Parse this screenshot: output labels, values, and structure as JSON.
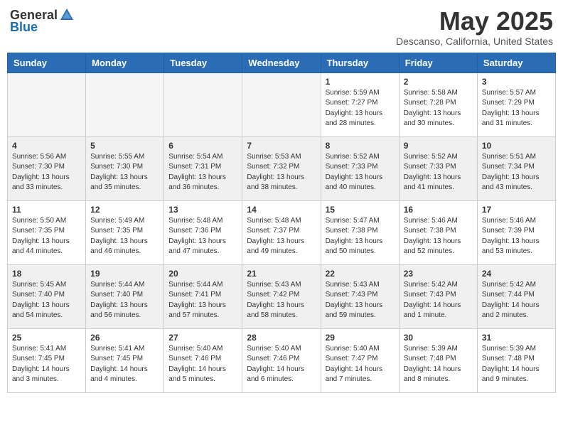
{
  "header": {
    "logo_general": "General",
    "logo_blue": "Blue",
    "month_title": "May 2025",
    "subtitle": "Descanso, California, United States"
  },
  "days_of_week": [
    "Sunday",
    "Monday",
    "Tuesday",
    "Wednesday",
    "Thursday",
    "Friday",
    "Saturday"
  ],
  "weeks": [
    [
      {
        "day": "",
        "info": ""
      },
      {
        "day": "",
        "info": ""
      },
      {
        "day": "",
        "info": ""
      },
      {
        "day": "",
        "info": ""
      },
      {
        "day": "1",
        "info": "Sunrise: 5:59 AM\nSunset: 7:27 PM\nDaylight: 13 hours\nand 28 minutes."
      },
      {
        "day": "2",
        "info": "Sunrise: 5:58 AM\nSunset: 7:28 PM\nDaylight: 13 hours\nand 30 minutes."
      },
      {
        "day": "3",
        "info": "Sunrise: 5:57 AM\nSunset: 7:29 PM\nDaylight: 13 hours\nand 31 minutes."
      }
    ],
    [
      {
        "day": "4",
        "info": "Sunrise: 5:56 AM\nSunset: 7:30 PM\nDaylight: 13 hours\nand 33 minutes."
      },
      {
        "day": "5",
        "info": "Sunrise: 5:55 AM\nSunset: 7:30 PM\nDaylight: 13 hours\nand 35 minutes."
      },
      {
        "day": "6",
        "info": "Sunrise: 5:54 AM\nSunset: 7:31 PM\nDaylight: 13 hours\nand 36 minutes."
      },
      {
        "day": "7",
        "info": "Sunrise: 5:53 AM\nSunset: 7:32 PM\nDaylight: 13 hours\nand 38 minutes."
      },
      {
        "day": "8",
        "info": "Sunrise: 5:52 AM\nSunset: 7:33 PM\nDaylight: 13 hours\nand 40 minutes."
      },
      {
        "day": "9",
        "info": "Sunrise: 5:52 AM\nSunset: 7:33 PM\nDaylight: 13 hours\nand 41 minutes."
      },
      {
        "day": "10",
        "info": "Sunrise: 5:51 AM\nSunset: 7:34 PM\nDaylight: 13 hours\nand 43 minutes."
      }
    ],
    [
      {
        "day": "11",
        "info": "Sunrise: 5:50 AM\nSunset: 7:35 PM\nDaylight: 13 hours\nand 44 minutes."
      },
      {
        "day": "12",
        "info": "Sunrise: 5:49 AM\nSunset: 7:35 PM\nDaylight: 13 hours\nand 46 minutes."
      },
      {
        "day": "13",
        "info": "Sunrise: 5:48 AM\nSunset: 7:36 PM\nDaylight: 13 hours\nand 47 minutes."
      },
      {
        "day": "14",
        "info": "Sunrise: 5:48 AM\nSunset: 7:37 PM\nDaylight: 13 hours\nand 49 minutes."
      },
      {
        "day": "15",
        "info": "Sunrise: 5:47 AM\nSunset: 7:38 PM\nDaylight: 13 hours\nand 50 minutes."
      },
      {
        "day": "16",
        "info": "Sunrise: 5:46 AM\nSunset: 7:38 PM\nDaylight: 13 hours\nand 52 minutes."
      },
      {
        "day": "17",
        "info": "Sunrise: 5:46 AM\nSunset: 7:39 PM\nDaylight: 13 hours\nand 53 minutes."
      }
    ],
    [
      {
        "day": "18",
        "info": "Sunrise: 5:45 AM\nSunset: 7:40 PM\nDaylight: 13 hours\nand 54 minutes."
      },
      {
        "day": "19",
        "info": "Sunrise: 5:44 AM\nSunset: 7:40 PM\nDaylight: 13 hours\nand 56 minutes."
      },
      {
        "day": "20",
        "info": "Sunrise: 5:44 AM\nSunset: 7:41 PM\nDaylight: 13 hours\nand 57 minutes."
      },
      {
        "day": "21",
        "info": "Sunrise: 5:43 AM\nSunset: 7:42 PM\nDaylight: 13 hours\nand 58 minutes."
      },
      {
        "day": "22",
        "info": "Sunrise: 5:43 AM\nSunset: 7:43 PM\nDaylight: 13 hours\nand 59 minutes."
      },
      {
        "day": "23",
        "info": "Sunrise: 5:42 AM\nSunset: 7:43 PM\nDaylight: 14 hours\nand 1 minute."
      },
      {
        "day": "24",
        "info": "Sunrise: 5:42 AM\nSunset: 7:44 PM\nDaylight: 14 hours\nand 2 minutes."
      }
    ],
    [
      {
        "day": "25",
        "info": "Sunrise: 5:41 AM\nSunset: 7:45 PM\nDaylight: 14 hours\nand 3 minutes."
      },
      {
        "day": "26",
        "info": "Sunrise: 5:41 AM\nSunset: 7:45 PM\nDaylight: 14 hours\nand 4 minutes."
      },
      {
        "day": "27",
        "info": "Sunrise: 5:40 AM\nSunset: 7:46 PM\nDaylight: 14 hours\nand 5 minutes."
      },
      {
        "day": "28",
        "info": "Sunrise: 5:40 AM\nSunset: 7:46 PM\nDaylight: 14 hours\nand 6 minutes."
      },
      {
        "day": "29",
        "info": "Sunrise: 5:40 AM\nSunset: 7:47 PM\nDaylight: 14 hours\nand 7 minutes."
      },
      {
        "day": "30",
        "info": "Sunrise: 5:39 AM\nSunset: 7:48 PM\nDaylight: 14 hours\nand 8 minutes."
      },
      {
        "day": "31",
        "info": "Sunrise: 5:39 AM\nSunset: 7:48 PM\nDaylight: 14 hours\nand 9 minutes."
      }
    ]
  ]
}
